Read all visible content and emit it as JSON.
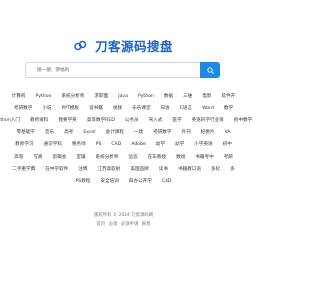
{
  "brand": {
    "title": "刀客源码搜盘",
    "logo": "link-icon",
    "accent": "#1f63c9"
  },
  "search": {
    "placeholder": "搜一搜、领福利",
    "button_icon": "search-icon",
    "button_color": "#1e88e5"
  },
  "tags": [
    [
      "计算机",
      "Python",
      "系统分析师",
      "求职面",
      "Java",
      "Python",
      "数据",
      "三维",
      "电影",
      "软件开"
    ],
    [
      "考研数学",
      "小说",
      "PPT模板",
      "读书籍",
      "视频",
      "乐乐课堂",
      "日语",
      "C语言",
      "Word",
      "数学"
    ],
    [
      "Python入门",
      "教师资料",
      "我要学英",
      "高等数学RED",
      "公务员",
      "驾入式",
      "医学",
      "英语的学行业资",
      "初中数学"
    ],
    [
      "零基础学",
      "音乐",
      "高考",
      "Excel",
      "会计课程",
      "一建",
      "考研数学",
      "外刊",
      "纪委片",
      "VA"
    ],
    [
      "教师学习",
      "通识学科",
      "税务师",
      "PS",
      "CAD",
      "Adobe",
      "幼学",
      "幼学",
      "小学英语",
      "初中"
    ],
    [
      "高等",
      "写真",
      "剪辑会",
      "室辅",
      "系统分析师",
      "远答",
      "在车教授",
      "数组",
      "书籍考中",
      "考研"
    ],
    [
      "二手重学典",
      "在中学软件",
      "注明",
      "江苏高软射",
      "美国品牌",
      "读书",
      "书籍教口语",
      "多轮",
      "多"
    ],
    [
      "PS教程",
      "安全培训",
      "四办公开学",
      "C4D"
    ]
  ],
  "footer": {
    "copyright": "版权所有 © 2024 刀客源码网",
    "links": [
      "首页",
      "必须",
      "必须申请",
      "网易"
    ]
  }
}
